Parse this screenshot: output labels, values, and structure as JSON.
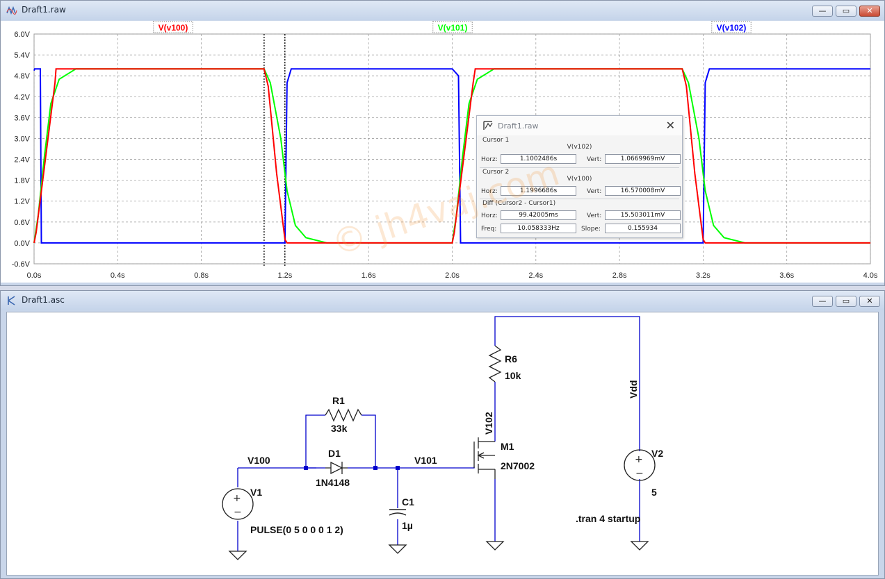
{
  "plot_window": {
    "title": "Draft1.raw",
    "traces": [
      {
        "label": "V(v100)",
        "color": "#ff0000"
      },
      {
        "label": "V(v101)",
        "color": "#00ff00"
      },
      {
        "label": "V(v102)",
        "color": "#0000ff"
      }
    ],
    "y_ticks": [
      "6.0V",
      "5.4V",
      "4.8V",
      "4.2V",
      "3.6V",
      "3.0V",
      "2.4V",
      "1.8V",
      "1.2V",
      "0.6V",
      "0.0V",
      "-0.6V"
    ],
    "x_ticks": [
      "0.0s",
      "0.4s",
      "0.8s",
      "1.2s",
      "1.6s",
      "2.0s",
      "2.4s",
      "2.8s",
      "3.2s",
      "3.6s",
      "4.0s"
    ]
  },
  "chart_data": {
    "type": "line",
    "xlabel": "",
    "ylabel": "",
    "xlim": [
      0,
      4.0
    ],
    "ylim": [
      -0.6,
      6.0
    ],
    "grid": true,
    "legend": "top",
    "series": [
      {
        "name": "V(v100)",
        "color": "#ff0000",
        "x": [
          0.0,
          0.01,
          0.05,
          0.1,
          0.105,
          1.1,
          1.12,
          1.16,
          1.2,
          1.21,
          2.0,
          2.01,
          2.05,
          2.1,
          2.11,
          3.1,
          3.12,
          3.16,
          3.2,
          3.21,
          4.0
        ],
        "y": [
          0.0,
          0.3,
          2.2,
          4.6,
          5.0,
          5.0,
          4.5,
          2.0,
          0.1,
          0.0,
          0.0,
          0.3,
          2.2,
          4.6,
          5.0,
          5.0,
          4.5,
          2.0,
          0.1,
          0.0,
          0.0
        ]
      },
      {
        "name": "V(v101)",
        "color": "#00ff00",
        "x": [
          0.0,
          0.02,
          0.05,
          0.08,
          0.12,
          0.2,
          1.1,
          1.13,
          1.18,
          1.21,
          1.25,
          1.3,
          1.4,
          2.0,
          2.02,
          2.05,
          2.08,
          2.12,
          2.2,
          3.1,
          3.13,
          3.18,
          3.21,
          3.25,
          3.3,
          3.4,
          4.0
        ],
        "y": [
          0.0,
          0.8,
          2.5,
          4.0,
          4.7,
          5.0,
          5.0,
          4.6,
          3.0,
          1.5,
          0.5,
          0.15,
          0.0,
          0.0,
          0.8,
          2.5,
          4.0,
          4.7,
          5.0,
          5.0,
          4.6,
          3.0,
          1.5,
          0.5,
          0.15,
          0.0,
          0.0
        ]
      },
      {
        "name": "V(v102)",
        "color": "#0000ff",
        "x": [
          0.0,
          0.003,
          0.03,
          0.035,
          1.2,
          1.21,
          1.23,
          2.0,
          2.03,
          2.04,
          3.2,
          3.21,
          3.23,
          4.0
        ],
        "y": [
          4.95,
          5.0,
          5.0,
          0.0,
          0.0,
          4.6,
          5.0,
          5.0,
          4.8,
          0.0,
          0.0,
          4.6,
          5.0,
          5.0
        ]
      }
    ]
  },
  "cursor_dialog": {
    "title": "Draft1.raw",
    "cursor1_label": "Cursor 1",
    "cursor1_trace": "V(v102)",
    "horz_label": "Horz:",
    "vert_label": "Vert:",
    "cursor1_horz": "1.1002486s",
    "cursor1_vert": "1.0669969mV",
    "cursor2_label": "Cursor 2",
    "cursor2_trace": "V(v100)",
    "cursor2_horz": "1.1996686s",
    "cursor2_vert": "16.570008mV",
    "diff_label": "Diff (Cursor2 - Cursor1)",
    "diff_horz": "99.42005ms",
    "diff_vert": "15.503011mV",
    "freq_label": "Freq:",
    "freq": "10.058333Hz",
    "slope_label": "Slope:",
    "slope": "0.155934",
    "cursor1_x": 1.1002486,
    "cursor2_x": 1.1996686
  },
  "schematic_window": {
    "title": "Draft1.asc",
    "labels": {
      "v100": "V100",
      "v101": "V101",
      "v102": "V102",
      "vdd": "Vdd",
      "r1_name": "R1",
      "r1_value": "33k",
      "d1_name": "D1",
      "d1_value": "1N4148",
      "c1_name": "C1",
      "c1_value": "1µ",
      "r6_name": "R6",
      "r6_value": "10k",
      "m1_name": "M1",
      "m1_value": "2N7002",
      "v1_name": "V1",
      "v1_value": "PULSE(0 5 0 0 0 1 2)",
      "v2_name": "V2",
      "v2_value": "5",
      "directive": ".tran 4 startup"
    }
  },
  "watermark": "© jh4vaj.com"
}
